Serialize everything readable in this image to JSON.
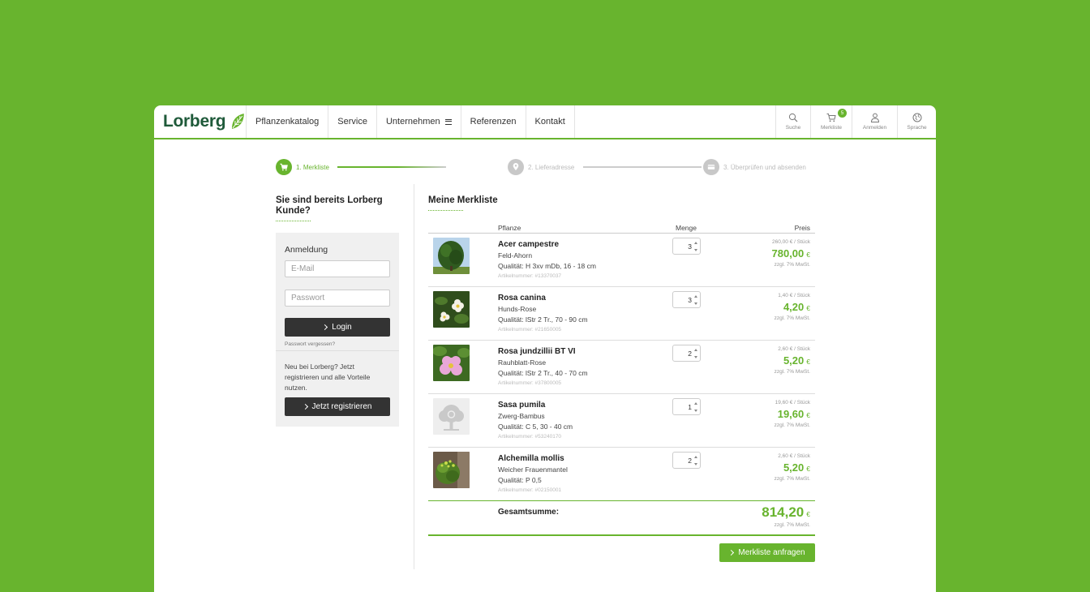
{
  "brand": {
    "name": "Lorberg",
    "accent": "#68b42e",
    "dark": "#1f5a3a"
  },
  "nav": [
    {
      "label": "Pflanzenkatalog"
    },
    {
      "label": "Service"
    },
    {
      "label": "Unternehmen"
    },
    {
      "label": "Referenzen"
    },
    {
      "label": "Kontakt"
    }
  ],
  "tools": {
    "search": {
      "label": "Suche",
      "icon": "search-icon"
    },
    "cart": {
      "label": "Merkliste",
      "icon": "cart-icon",
      "badge": "5"
    },
    "login": {
      "label": "Anmelden",
      "icon": "user-icon"
    },
    "language": {
      "label": "Sprache",
      "icon": "globe-icon"
    }
  },
  "steps": [
    {
      "label": "1. Merkliste",
      "icon": "cart-icon",
      "active": true
    },
    {
      "label": "2. Lieferadresse",
      "icon": "location-pin-icon",
      "active": false
    },
    {
      "label": "3. Überprüfen und absenden",
      "icon": "card-icon",
      "active": false
    }
  ],
  "login": {
    "title": "Sie sind bereits Lorberg Kunde?",
    "heading": "Anmeldung",
    "email_placeholder": "E-Mail",
    "password_placeholder": "Passwort",
    "login_label": "Login",
    "forgot_label": "Passwort vergessen?",
    "register_text": "Neu bei Lorberg? Jetzt registrieren und alle Vorteile nutzen.",
    "register_label": "Jetzt registrieren"
  },
  "list": {
    "title": "Meine Merkliste",
    "headers": {
      "plant": "Pflanze",
      "qty": "Menge",
      "price": "Preis"
    },
    "items": [
      {
        "name": "Acer campestre",
        "german": "Feld-Ahorn",
        "quality": "Qualität: H 3xv mDb, 16 - 18 cm",
        "article": "Artikelnummer: #13370037",
        "qty": "3",
        "unit_price": "260,00 € / Stück",
        "price": "780,00",
        "currency": "€",
        "vat": "zzgl. 7% MwSt.",
        "image": "tree-photo"
      },
      {
        "name": "Rosa canina",
        "german": "Hunds-Rose",
        "quality": "Qualität: lStr 2 Tr., 70 - 90 cm",
        "article": "Artikelnummer: #21650005",
        "qty": "3",
        "unit_price": "1,40 € / Stück",
        "price": "4,20",
        "currency": "€",
        "vat": "zzgl. 7% MwSt.",
        "image": "white-rose-photo"
      },
      {
        "name": "Rosa jundzillii BT VI",
        "german": "Rauhblatt-Rose",
        "quality": "Qualität: lStr 2 Tr., 40 - 70 cm",
        "article": "Artikelnummer: #37800005",
        "qty": "2",
        "unit_price": "2,60 € / Stück",
        "price": "5,20",
        "currency": "€",
        "vat": "zzgl. 7% MwSt.",
        "image": "pink-rose-photo"
      },
      {
        "name": "Sasa pumila",
        "german": "Zwerg-Bambus",
        "quality": "Qualität: C 5, 30 - 40 cm",
        "article": "Artikelnummer: #53240170",
        "qty": "1",
        "unit_price": "19,60 € / Stück",
        "price": "19,60",
        "currency": "€",
        "vat": "zzgl. 7% MwSt.",
        "image": "placeholder-tree-icon"
      },
      {
        "name": "Alchemilla mollis",
        "german": "Weicher Frauenmantel",
        "quality": "Qualität: P 0,5",
        "article": "Artikelnummer: #02150001",
        "qty": "2",
        "unit_price": "2,60 € / Stück",
        "price": "5,20",
        "currency": "€",
        "vat": "zzgl. 7% MwSt.",
        "image": "lady-mantle-photo"
      }
    ],
    "total_label": "Gesamtsumme:",
    "total": "814,20",
    "total_currency": "€",
    "total_vat": "zzgl. 7% MwSt.",
    "submit_label": "Merkliste anfragen"
  }
}
